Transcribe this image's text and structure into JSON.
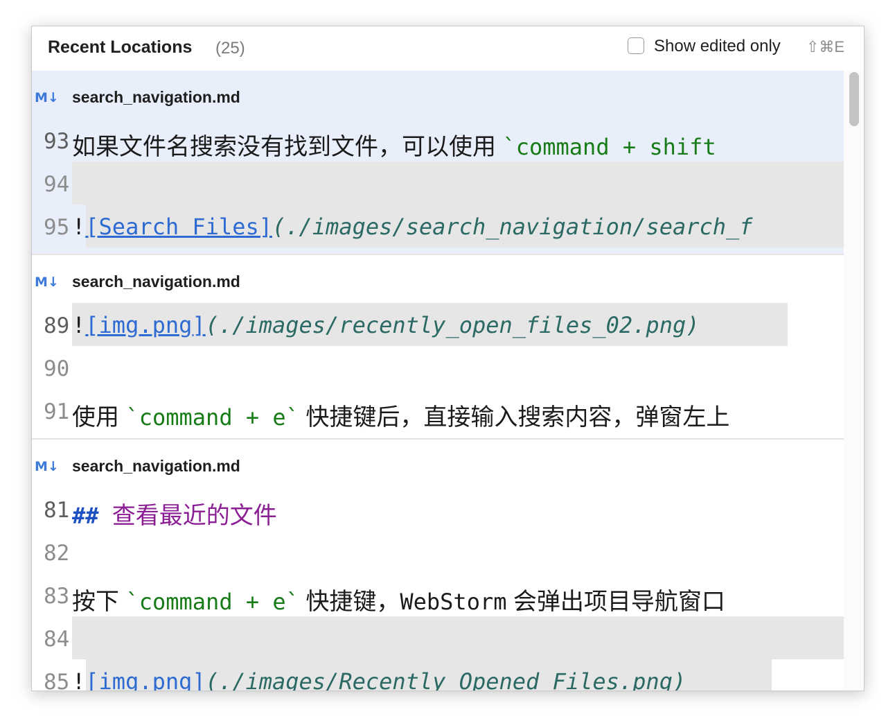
{
  "header": {
    "title": "Recent Locations",
    "count": "(25)",
    "toggle_label": "Show edited only",
    "toggle_checked": false,
    "shortcut": "⇧⌘E"
  },
  "groups": [
    {
      "icon": "markdown-icon",
      "icon_text": "M↓",
      "file": "search_navigation.md",
      "selected": true,
      "lines": [
        {
          "num": "93",
          "a": "如果文件名搜索没有找到文件，可以使用 ",
          "b": "`",
          "c": "command + shift"
        },
        {
          "num": "94"
        },
        {
          "num": "95",
          "a": "!",
          "b": "[Search Files]",
          "c": "(./images/search_navigation/search_f"
        }
      ]
    },
    {
      "icon": "markdown-icon",
      "icon_text": "M↓",
      "file": "search_navigation.md",
      "selected": false,
      "lines": [
        {
          "num": "89",
          "a": "!",
          "b": "[img.png]",
          "c": "(./images/recently_open_files_02.png)"
        },
        {
          "num": "90"
        },
        {
          "num": "91",
          "a": "使用 ",
          "b": "`command + e`",
          "c": " 快捷键后，直接输入搜索内容，弹窗左上"
        }
      ]
    },
    {
      "icon": "markdown-icon",
      "icon_text": "M↓",
      "file": "search_navigation.md",
      "selected": false,
      "lines": [
        {
          "num": "81",
          "a": "## ",
          "b": "查看最近的文件"
        },
        {
          "num": "82"
        },
        {
          "num": "83",
          "a": "按下 ",
          "b": "`command + e`",
          "c": " 快捷键，",
          "d": "WebStorm",
          "e": " 会弹出项目导航窗口"
        },
        {
          "num": "84"
        },
        {
          "num": "85",
          "a": "!",
          "b": "[img.png]",
          "c": "(./images/Recently_Opened_Files.png)"
        }
      ]
    }
  ]
}
